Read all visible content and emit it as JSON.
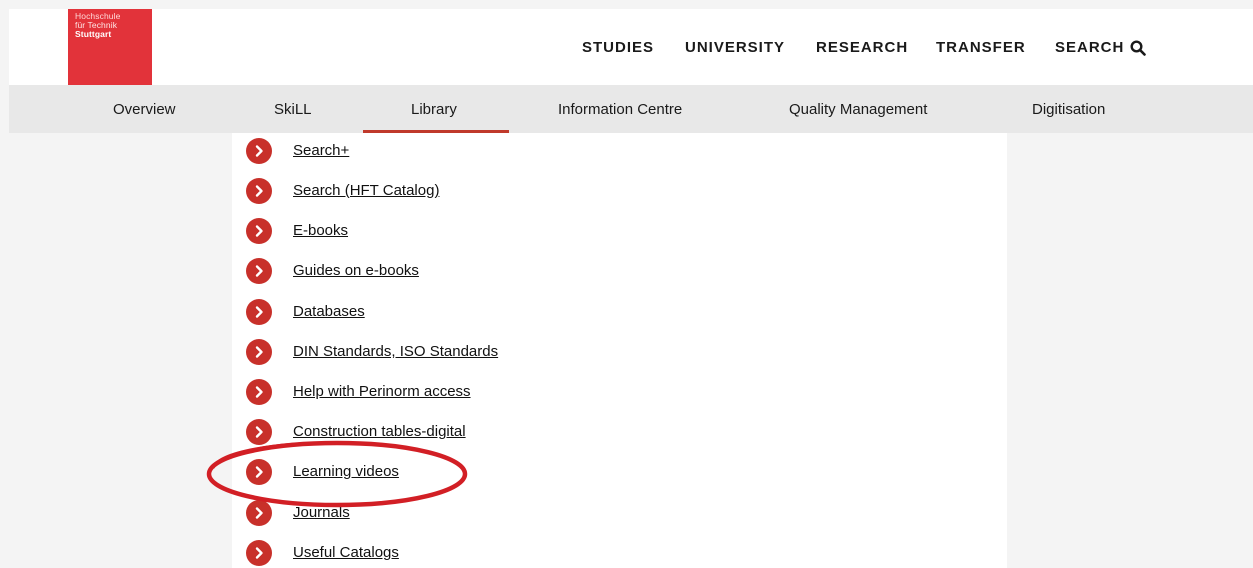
{
  "logo": {
    "line1": "Hochschule",
    "line2": "für Technik",
    "line3": "Stuttgart"
  },
  "main_nav": [
    "STUDIES",
    "UNIVERSITY",
    "RESEARCH",
    "TRANSFER",
    "SEARCH"
  ],
  "sub_nav": [
    "Overview",
    "SkiLL",
    "Library",
    "Information Centre",
    "Quality Management",
    "Digitisation"
  ],
  "active_tab": "Library",
  "links": [
    "Search+",
    "Search (HFT Catalog)",
    "E-books",
    "Guides on e-books",
    "Databases",
    "DIN Standards, ISO Standards",
    "Help with Perinorm access",
    "Construction tables-digital",
    "Learning videos",
    "Journals",
    "Useful Catalogs"
  ],
  "highlighted_link": "Learning videos",
  "colors": {
    "brand": "#e2333a",
    "icon": "#c8302a",
    "highlight": "#d21f25"
  }
}
